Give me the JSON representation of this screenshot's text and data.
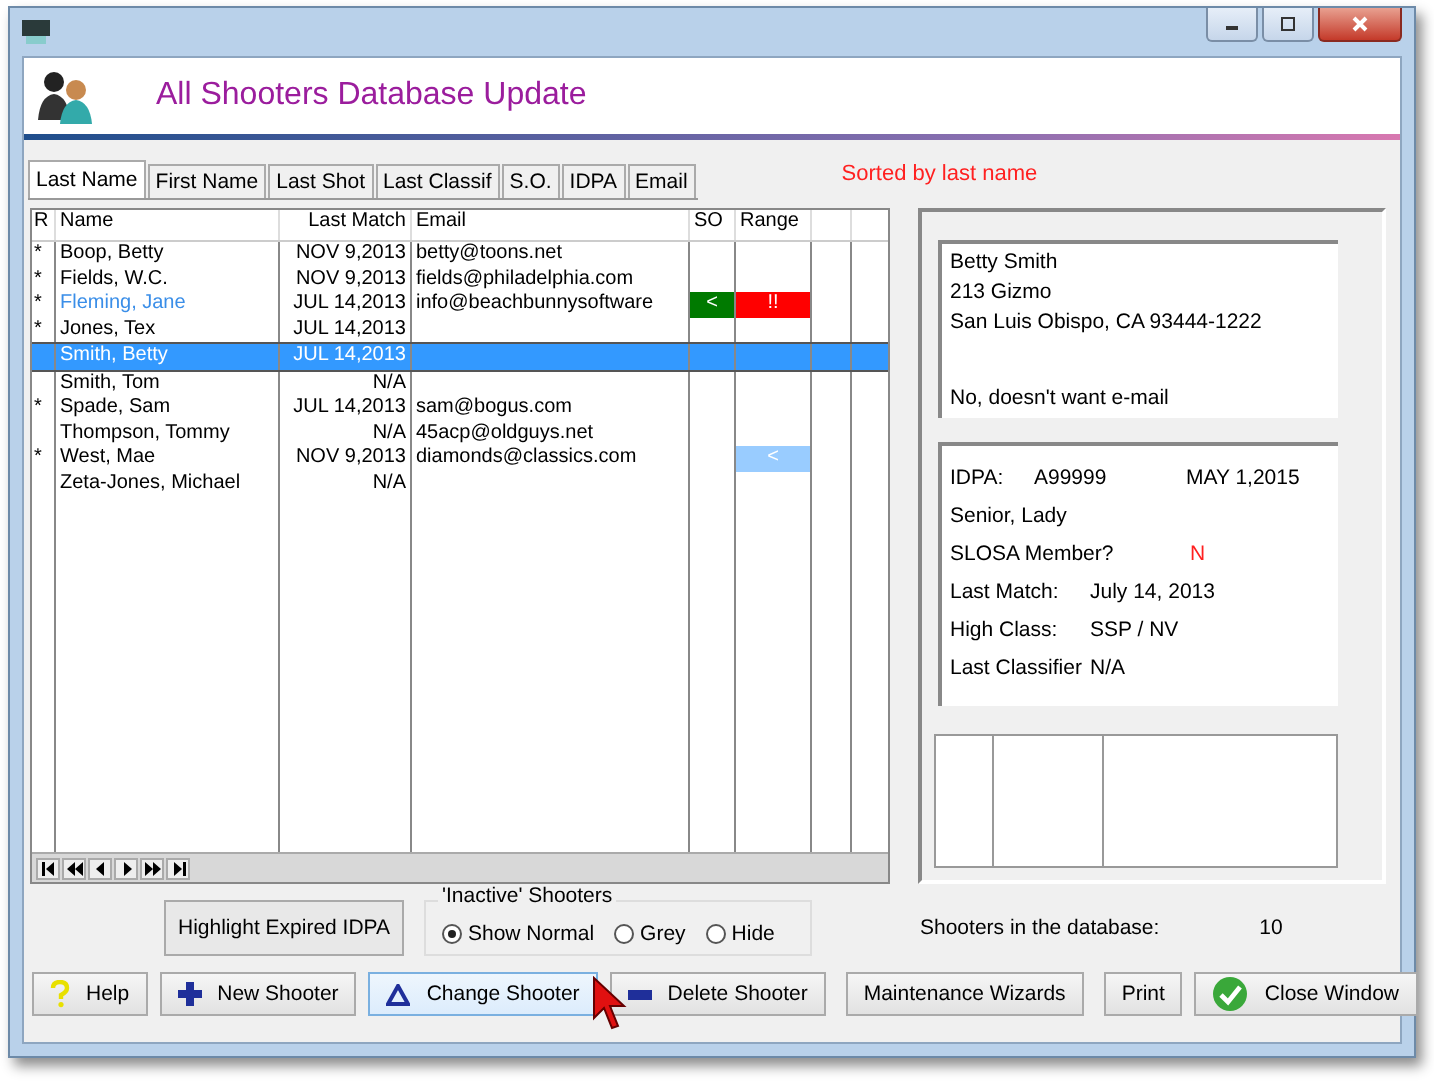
{
  "window": {
    "title": "All Shooters Database Update"
  },
  "tabs": [
    {
      "label": "Last Name",
      "selected": true
    },
    {
      "label": "First Name",
      "selected": false
    },
    {
      "label": "Last Shot",
      "selected": false
    },
    {
      "label": "Last Classif",
      "selected": false
    },
    {
      "label": "S.O.",
      "selected": false
    },
    {
      "label": "IDPA",
      "selected": false
    },
    {
      "label": "Email",
      "selected": false
    }
  ],
  "sort_note": "Sorted by last name",
  "table": {
    "columns": [
      "R",
      "Name",
      "Last Match",
      "Email",
      "SO",
      "Range"
    ],
    "rows": [
      {
        "r": "*",
        "name": "Boop, Betty",
        "last_match": "NOV  9,2013",
        "email": "betty@toons.net",
        "highlight": false,
        "selected": false
      },
      {
        "r": "*",
        "name": "Fields, W.C.",
        "last_match": "NOV  9,2013",
        "email": "fields@philadelphia.com",
        "highlight": false,
        "selected": false
      },
      {
        "r": "*",
        "name": "Fleming, Jane",
        "last_match": "JUL 14,2013",
        "email": "info@beachbunnysoftware",
        "highlight": true,
        "selected": false,
        "so": {
          "text": "<",
          "color": "#007a00"
        },
        "range": {
          "text": "!!",
          "color": "#ff0000"
        }
      },
      {
        "r": "*",
        "name": "Jones, Tex",
        "last_match": "JUL 14,2013",
        "highlight": false,
        "selected": false
      },
      {
        "name": "Smith, Betty",
        "last_match": "JUL 14,2013",
        "highlight": false,
        "selected": true
      },
      {
        "name": "Smith, Tom",
        "last_match": "N/A",
        "highlight": false,
        "selected": false
      },
      {
        "r": "*",
        "name": "Spade, Sam",
        "last_match": "JUL 14,2013",
        "email": "sam@bogus.com",
        "highlight": false,
        "selected": false
      },
      {
        "name": "Thompson, Tommy",
        "last_match": "N/A",
        "email": "45acp@oldguys.net",
        "highlight": false,
        "selected": false
      },
      {
        "r": "*",
        "name": "West, Mae",
        "last_match": "NOV  9,2013",
        "email": "diamonds@classics.com",
        "highlight": false,
        "selected": false,
        "range": {
          "text": "<",
          "color": "#99ccff"
        }
      },
      {
        "name": "Zeta-Jones, Michael",
        "last_match": "N/A",
        "highlight": false,
        "selected": false
      }
    ]
  },
  "address": {
    "lines": [
      "Betty  Smith",
      "213 Gizmo",
      "San Luis Obispo, CA  93444-1222"
    ],
    "email_note": "No, doesn't want e-mail"
  },
  "info": {
    "idpa_label": "IDPA:",
    "idpa_number": "A99999",
    "idpa_date": "MAY  1,2015",
    "division": "Senior,  Lady",
    "slosa_label": "SLOSA Member?",
    "slosa_value": "N",
    "fields": [
      {
        "label": "Last Match:",
        "value": "July 14, 2013"
      },
      {
        "label": "High Class:",
        "value": "SSP / NV"
      },
      {
        "label": "Last Classifier",
        "value": "N/A"
      }
    ]
  },
  "highlight_button": "Highlight  Expired IDPA",
  "inactive_group": {
    "title": "'Inactive' Shooters",
    "options": [
      {
        "label": "Show Normal",
        "selected": true
      },
      {
        "label": "Grey",
        "selected": false
      },
      {
        "label": "Hide",
        "selected": false
      }
    ]
  },
  "count": {
    "label": "Shooters in the database:",
    "value": "10"
  },
  "buttons": [
    {
      "label": "Help",
      "kind": "help"
    },
    {
      "label": "New Shooter",
      "kind": "new"
    },
    {
      "label": "Change Shooter",
      "kind": "change"
    },
    {
      "label": "Delete Shooter",
      "kind": "delete"
    },
    {
      "label": "Maintenance Wizards",
      "kind": "plain"
    },
    {
      "label": "Print",
      "kind": "plain"
    },
    {
      "label": "Close Window",
      "kind": "close"
    }
  ]
}
